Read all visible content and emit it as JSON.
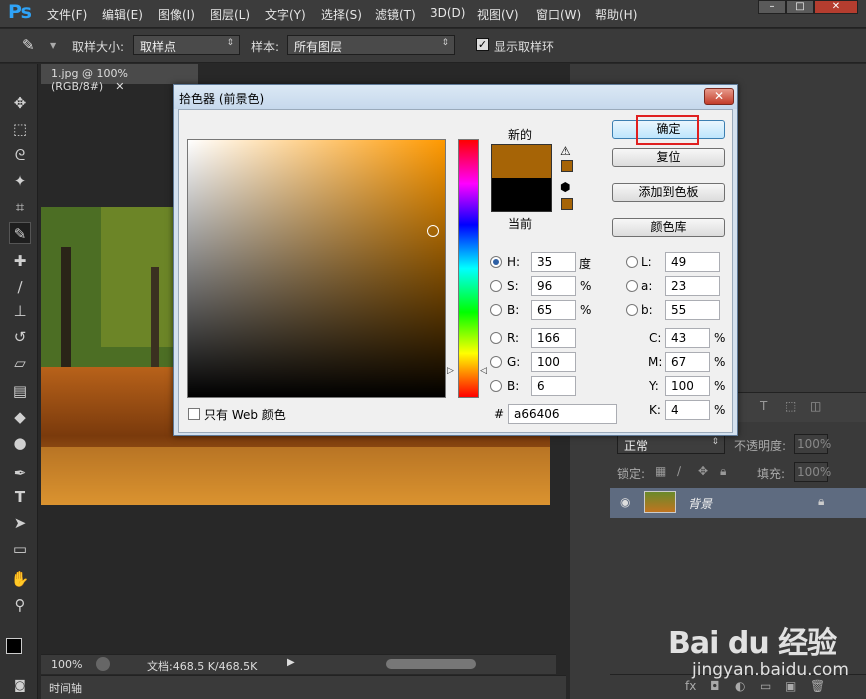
{
  "app": {
    "logo": "Ps",
    "menus": [
      "文件(F)",
      "编辑(E)",
      "图像(I)",
      "图层(L)",
      "文字(Y)",
      "选择(S)",
      "滤镜(T)",
      "3D(D)",
      "视图(V)",
      "窗口(W)",
      "帮助(H)"
    ]
  },
  "options": {
    "sample_size_label": "取样大小:",
    "sample_size_value": "取样点",
    "sample_label": "样本:",
    "sample_value": "所有图层",
    "show_ring_label": "显示取样环",
    "show_ring_checked": true
  },
  "document": {
    "tab_title": "1.jpg @ 100%(RGB/8#)",
    "zoom": "100%",
    "doc_info": "文档:468.5 K/468.5K",
    "timeline_label": "时间轴"
  },
  "dialog": {
    "title": "拾色器 (前景色)",
    "new_label": "新的",
    "current_label": "当前",
    "new_color": "#a66406",
    "current_color": "#000000",
    "buttons": {
      "ok": "确定",
      "reset": "复位",
      "add_swatch": "添加到色板",
      "color_libraries": "颜色库"
    },
    "fields": {
      "H": {
        "label": "H:",
        "value": "35",
        "unit": "度"
      },
      "S": {
        "label": "S:",
        "value": "96",
        "unit": "%"
      },
      "Bv": {
        "label": "B:",
        "value": "65",
        "unit": "%"
      },
      "R": {
        "label": "R:",
        "value": "166"
      },
      "G": {
        "label": "G:",
        "value": "100"
      },
      "Bc": {
        "label": "B:",
        "value": "6"
      },
      "L": {
        "label": "L:",
        "value": "49"
      },
      "a": {
        "label": "a:",
        "value": "23"
      },
      "b": {
        "label": "b:",
        "value": "55"
      },
      "C": {
        "label": "C:",
        "value": "43",
        "unit": "%"
      },
      "M": {
        "label": "M:",
        "value": "67",
        "unit": "%"
      },
      "Y": {
        "label": "Y:",
        "value": "100",
        "unit": "%"
      },
      "K": {
        "label": "K:",
        "value": "4",
        "unit": "%"
      }
    },
    "hex_label": "#",
    "hex_value": "a66406",
    "web_only_label": "只有 Web 颜色",
    "hue_base": "#ff9900"
  },
  "layers": {
    "mode": "正常",
    "opacity_label": "不透明度:",
    "opacity_value": "100%",
    "lock_label": "锁定:",
    "fill_label": "填充:",
    "fill_value": "100%",
    "layer_name": "背景"
  },
  "watermark": {
    "brand": "Bai du 经验",
    "url": "jingyan.baidu.com"
  }
}
